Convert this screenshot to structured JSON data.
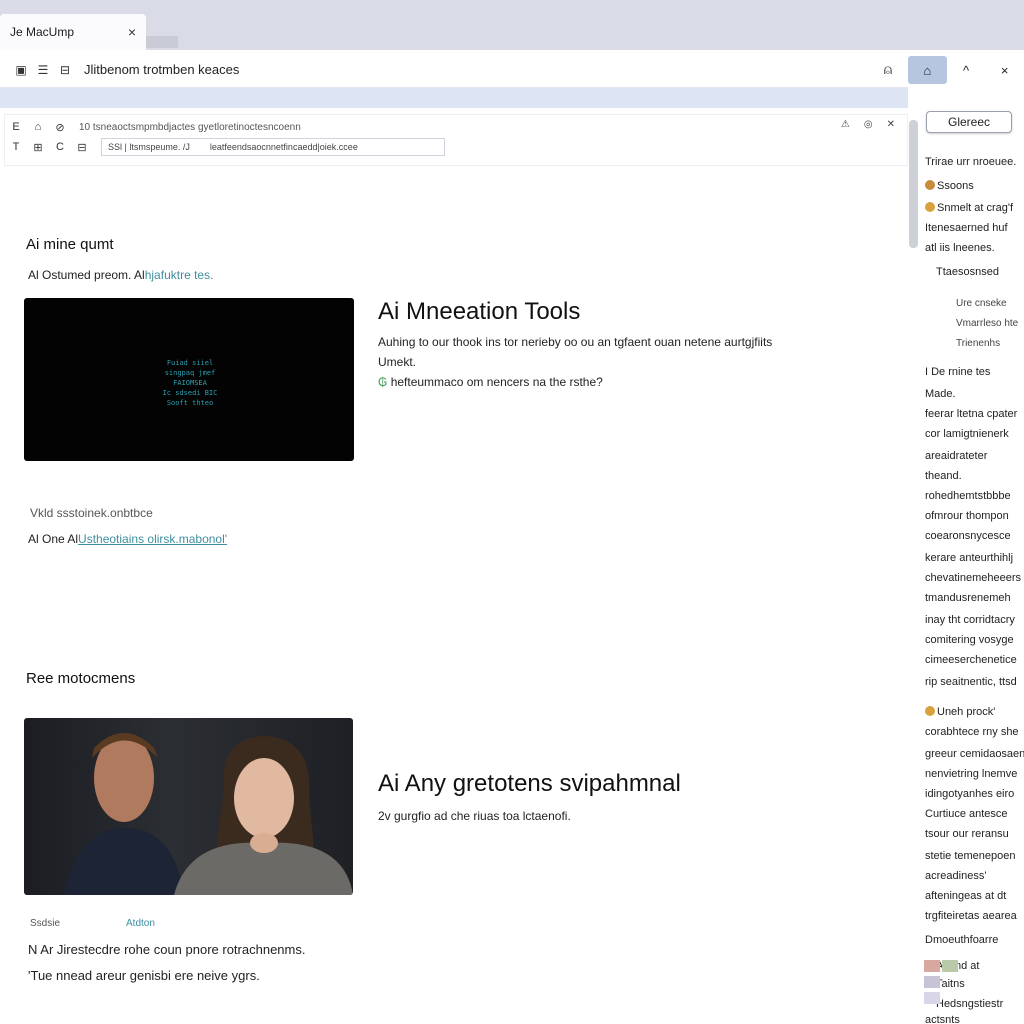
{
  "browser": {
    "tab_title": "Je MacUmp",
    "tab_close": "×",
    "address_text": "Jlitbenom trotmben keaces",
    "window_controls": [
      "⌂",
      "^",
      "×"
    ]
  },
  "toolbar": {
    "row1_text": "10 tsneaoctsmpmbdjactes gyetloretinoctesncoenn",
    "row2_field_a": "SSl | ltsmspeume. /J",
    "row2_field_b": "leatfeendsaocnnetfincaedd|oiek.ccee"
  },
  "main": {
    "section1": {
      "heading": "Ai mine qumt",
      "sub_plain": "Al Ostumed preom. Al",
      "sub_link": "hjafuktre tes.",
      "video_caption": [
        "Fuiad siiel",
        "singpaq jmef",
        "FAIOMSEA",
        "Ic sdsedi BIC",
        "Sooft thteo"
      ],
      "card_title": "Ai Mneeation Tools",
      "card_desc_line1": "Auhing to our thook ins tor nerieby oo ou an tgfaent ouan netene aurtgjfiits",
      "card_desc_line2": "Umekt.",
      "card_desc_line3_mark": "₲",
      "card_desc_line3": "hefteummaco om nencers na the rsthe?",
      "meta_label": "Vkld ssstoinek.onbtbce",
      "meta_prefix": "Al One Al",
      "meta_link": "Ustheotiains olirsk.mabonol'"
    },
    "section2": {
      "heading": "Ree motocmens",
      "card_title": "Ai Any gretotens svipahmnal",
      "card_desc": "2v gurgfio ad che riuas toa lctaenofi.",
      "small_label_a": "Ssdsie",
      "small_label_b": "Atdton",
      "footer_line1": "N Ar Jirestecdre rohe coun pnore rotrachnenms.",
      "footer_line2": "'Tue nnead areur genisbi ere neive ygrs."
    }
  },
  "sidepanel": {
    "button": "Glereec",
    "lines": [
      "Trirae urr nroeuee.",
      "Ssoons",
      "Snmelt at crag'f",
      "Itenesaerned huf",
      "atl iis lneenes.",
      "Ttaesosnsed",
      "Ure cnseke",
      "Vmarrleso hte",
      "Trienenhs",
      "I De rnine tes",
      "Made.",
      "feerar ltetna cpater",
      "cor lamigtnienerk",
      "areaidrateter",
      "theand.",
      "rohedhemtstbbbe",
      "ofmrour thompon",
      "coearonsnycesce",
      "kerare anteurthihlj",
      "chevatinemeheeers",
      "tmandusrenemeh",
      "inay tht corridtacry",
      "comitering vosyge",
      "cimeeserchenetice",
      "rip seaitnentic, ttsd",
      "Uneh prock'",
      "corabhtece rny she",
      "greeur cemidaosaens",
      "nenvietring lnemve",
      "idingotyanhes eiro",
      "Curtiuce antesce",
      "tsour our reransu",
      "stetie temenepoen",
      "acreadiness'",
      "afteningeas at dt",
      "trgfiteiretas aearea",
      "Dmoeuthfoarre",
      "Ai and at",
      "Taitns",
      "Hedsngstiestr",
      "actsnts"
    ],
    "mark_colors": [
      "#c98a3a",
      "#d9a13c",
      "#6b8bd6",
      "#8fb36b"
    ]
  }
}
